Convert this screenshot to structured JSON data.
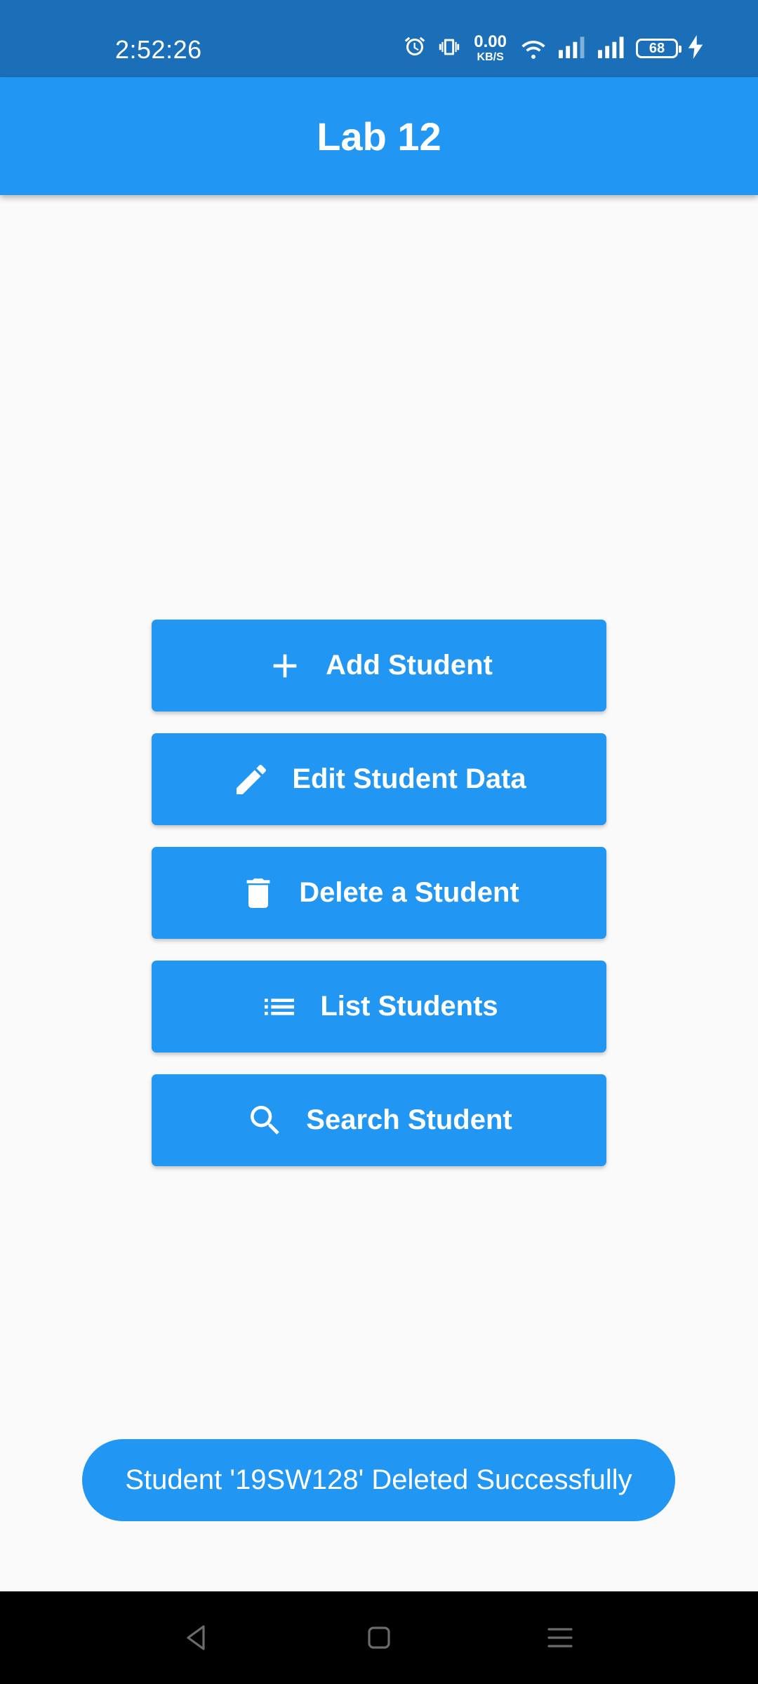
{
  "status_bar": {
    "time": "2:52:26",
    "net_speed_value": "0.00",
    "net_speed_unit": "KB/S",
    "battery_level": "68",
    "icons": [
      "alarm-icon",
      "vibrate-icon",
      "wifi-icon",
      "signal-icon",
      "signal-icon",
      "battery-icon",
      "charging-icon"
    ]
  },
  "app_bar": {
    "title": "Lab 12"
  },
  "actions": [
    {
      "label": "Add Student",
      "icon": "add-icon"
    },
    {
      "label": "Edit Student Data",
      "icon": "edit-pencil-icon"
    },
    {
      "label": "Delete a Student",
      "icon": "trash-icon"
    },
    {
      "label": "List Students",
      "icon": "list-icon"
    },
    {
      "label": "Search Student",
      "icon": "search-icon"
    }
  ],
  "toast": {
    "message": "Student '19SW128' Deleted Successfully"
  },
  "nav_bar": {
    "buttons": [
      "back-icon",
      "home-icon",
      "menu-icon"
    ]
  },
  "colors": {
    "primary": "#2196F3",
    "status_bar": "#1A6FB8",
    "background": "#FAFAFA",
    "nav_bar": "#000000"
  }
}
